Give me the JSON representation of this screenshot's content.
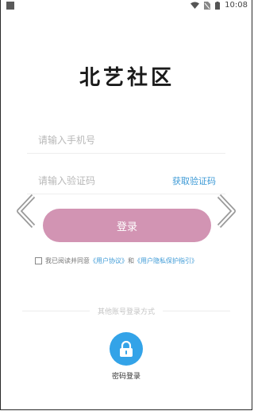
{
  "status_bar": {
    "time": "10:08"
  },
  "logo": {
    "text": "北艺社区"
  },
  "form": {
    "phone_placeholder": "请输入手机号",
    "code_placeholder": "请输入验证码",
    "get_code_label": "获取验证码",
    "login_label": "登录"
  },
  "agreement": {
    "prefix": "我已阅读并同意",
    "user_agreement": "《用户协议》",
    "and": "和",
    "privacy_policy": "《用户隐私保护指引》"
  },
  "other_login": {
    "divider_text": "其他账号登录方式",
    "password_login_label": "密码登录"
  },
  "colors": {
    "accent": "#d294b3",
    "link": "#3d9ad6",
    "password_icon_bg": "#33a3e8"
  }
}
